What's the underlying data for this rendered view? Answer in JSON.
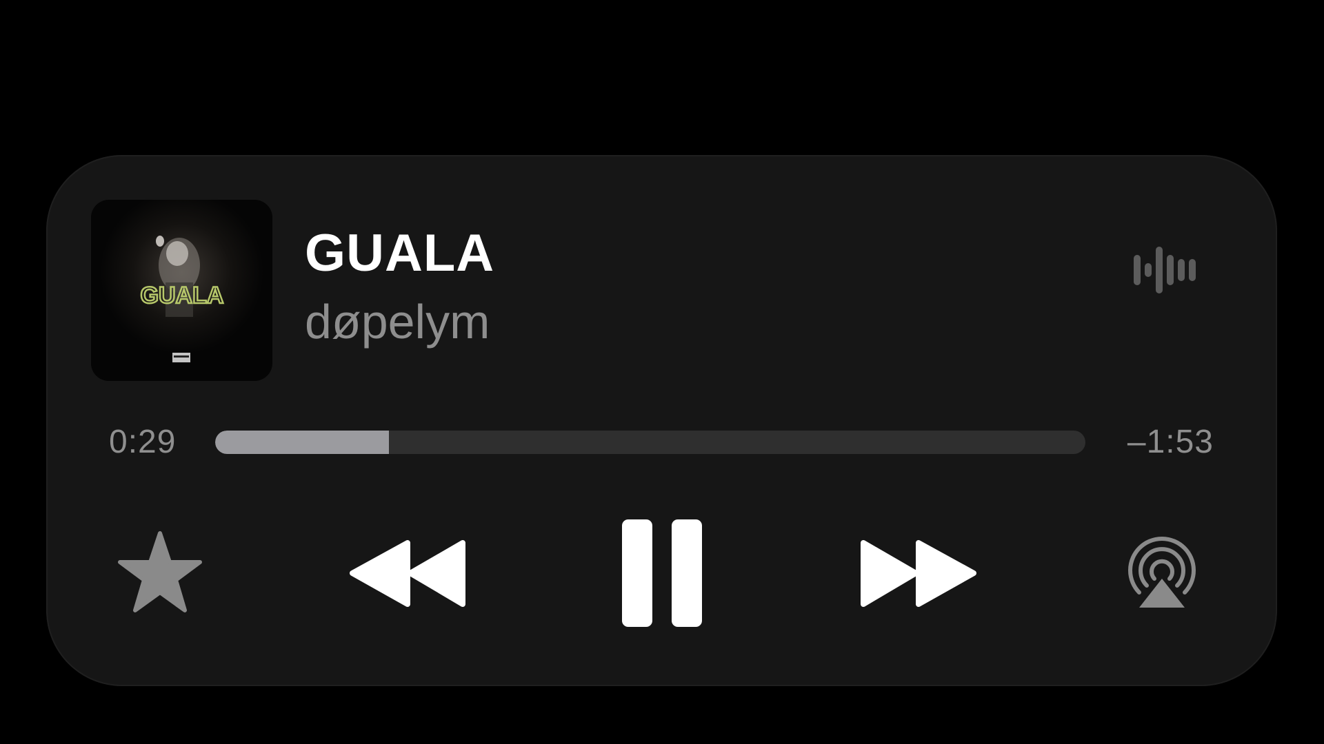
{
  "now_playing": {
    "title": "GUALA",
    "artist": "døpelym",
    "artwork_text": "GUALA"
  },
  "progress": {
    "elapsed": "0:29",
    "remaining": "–1:53",
    "fraction": 0.2
  },
  "controls": {
    "favorite": "star-icon",
    "previous": "rewind-icon",
    "play_pause": "pause-icon",
    "next": "fast-forward-icon",
    "output": "airplay-icon",
    "audio_indicator": "waveform-icon"
  },
  "colors": {
    "panel": "#161616",
    "title": "#ffffff",
    "artist": "#8e8e8e",
    "progress_fill": "#9b9b9f",
    "progress_track": "#2f2f2f",
    "artwork_text": "#b7c86a"
  }
}
